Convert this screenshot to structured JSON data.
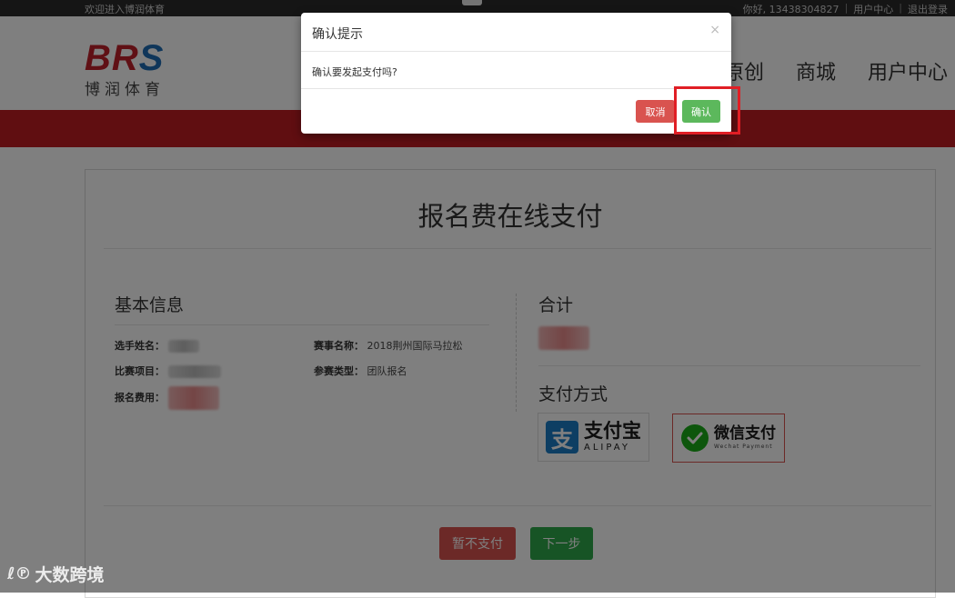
{
  "topbar": {
    "welcome": "欢迎进入博润体育",
    "greeting": "你好, 13438304827",
    "user_center": "用户中心",
    "logout": "退出登录",
    "separator": "|"
  },
  "logo": {
    "brand_letters": "BR",
    "brand_last_letter": "S",
    "brand_cn": "博润体育"
  },
  "nav": {
    "items": [
      "原创",
      "商城",
      "用户中心"
    ]
  },
  "card": {
    "title": "报名费在线支付",
    "basic_info_title": "基本信息",
    "fields": {
      "player_name_label": "选手姓名：",
      "event_name_label": "赛事名称：",
      "event_name_value": "2018荆州国际马拉松",
      "project_label": "比赛项目：",
      "entry_type_label": "参赛类型：",
      "entry_type_value": "团队报名",
      "fee_label": "报名费用："
    },
    "total_title": "合计",
    "pay_method_title": "支付方式",
    "alipay": {
      "icon_char": "支",
      "cn": "支付宝",
      "en": "ALIPAY"
    },
    "wechat": {
      "cn": "微信支付",
      "en": "Wechat Payment"
    },
    "buttons": {
      "no_pay": "暂不支付",
      "next": "下一步"
    }
  },
  "modal": {
    "title": "确认提示",
    "close": "×",
    "message": "确认要发起支付吗?",
    "cancel": "取消",
    "confirm": "确认"
  },
  "watermark": {
    "logo": "ℓ℗",
    "text": "大数跨境"
  },
  "colors": {
    "brand_red": "#c01d23",
    "cancel_red": "#d9534f",
    "confirm_green": "#5cb85c",
    "next_green": "#2ea84a",
    "highlight": "#e01e25",
    "alipay_blue": "#1a7cc7",
    "wechat_green": "#1aad19"
  }
}
